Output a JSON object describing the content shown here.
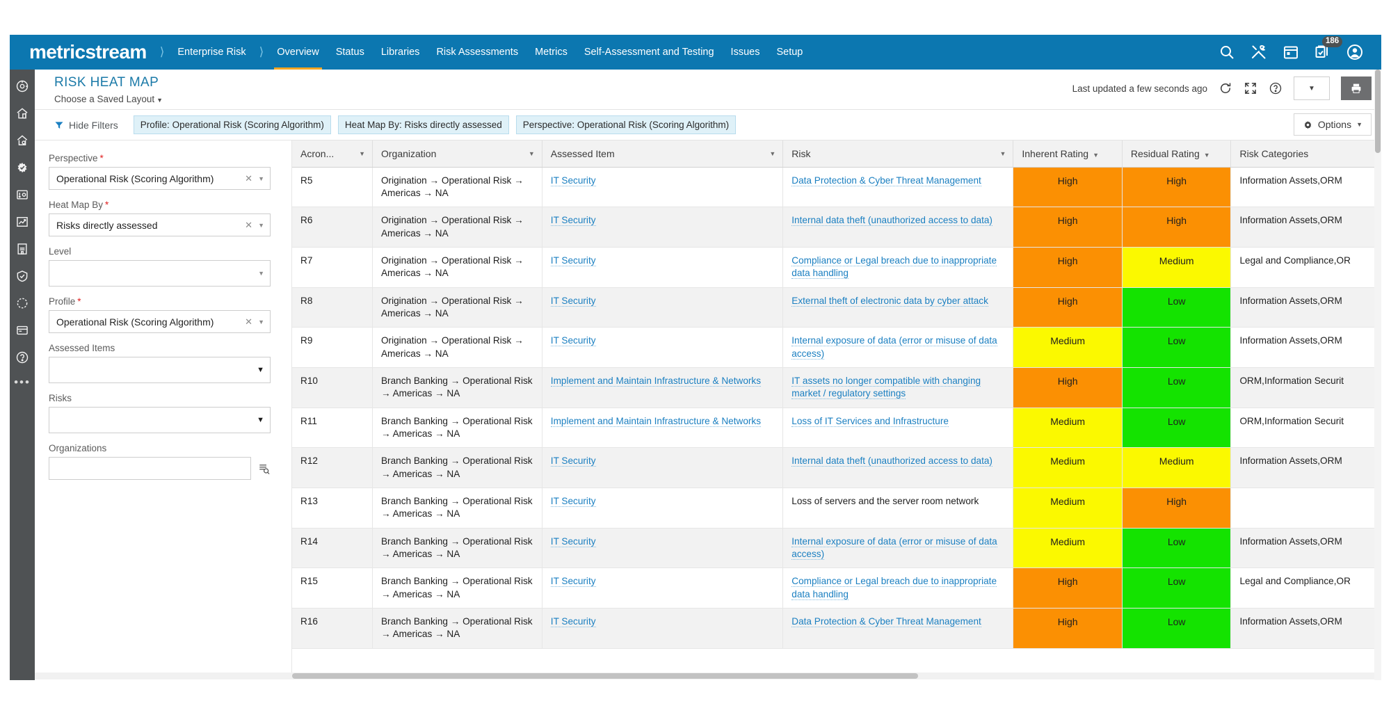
{
  "topnav": {
    "brand": "metricstream",
    "breadcrumb": "Enterprise Risk",
    "items": [
      {
        "label": "Overview",
        "active": true
      },
      {
        "label": "Status",
        "active": false
      },
      {
        "label": "Libraries",
        "active": false
      },
      {
        "label": "Risk Assessments",
        "active": false
      },
      {
        "label": "Metrics",
        "active": false
      },
      {
        "label": "Self-Assessment and Testing",
        "active": false
      },
      {
        "label": "Issues",
        "active": false
      },
      {
        "label": "Setup",
        "active": false
      }
    ],
    "icons": [
      "search-icon",
      "tools-icon",
      "calendar-icon",
      "tasks-icon",
      "user-avatar-icon"
    ],
    "task_badge": "186",
    "accent_color": "#0c77b0",
    "active_underline_color": "#f5a623"
  },
  "rail": {
    "icons": [
      "dashboard-icon",
      "home-risk-icon",
      "risk-icon",
      "gear-check-icon",
      "assessment-icon",
      "chart-trend-icon",
      "building-icon",
      "shield-icon",
      "refresh-cycle-icon",
      "archive-icon",
      "help-icon"
    ],
    "more": "•••"
  },
  "header": {
    "title": "RISK HEAT MAP",
    "saved_layout": "Choose a Saved Layout",
    "last_updated": "Last updated a few seconds ago",
    "actions": [
      "refresh-icon",
      "fullscreen-icon",
      "help-circle-icon",
      "dropdown-caret-button",
      "print-button"
    ]
  },
  "filterbar": {
    "toggle_label": "Hide Filters",
    "chips": [
      "Profile: Operational Risk (Scoring Algorithm)",
      "Heat Map By: Risks directly assessed",
      "Perspective: Operational Risk (Scoring Algorithm)"
    ],
    "options_label": "Options"
  },
  "filters": [
    {
      "label": "Perspective",
      "required": true,
      "value": "Operational Risk (Scoring Algorithm)",
      "clearable": true,
      "kind": "select"
    },
    {
      "label": "Heat Map By",
      "required": true,
      "value": "Risks directly assessed",
      "clearable": true,
      "kind": "select"
    },
    {
      "label": "Level",
      "required": false,
      "value": "",
      "clearable": false,
      "kind": "select"
    },
    {
      "label": "Profile",
      "required": true,
      "value": "Operational Risk (Scoring Algorithm)",
      "clearable": true,
      "kind": "select"
    },
    {
      "label": "Assessed Items",
      "required": false,
      "value": "",
      "clearable": false,
      "kind": "multiselect"
    },
    {
      "label": "Risks",
      "required": false,
      "value": "",
      "clearable": false,
      "kind": "multiselect"
    },
    {
      "label": "Organizations",
      "required": false,
      "value": "",
      "clearable": false,
      "kind": "lookup"
    }
  ],
  "table": {
    "columns": [
      {
        "label": "Acron...",
        "caret": true,
        "caret_inline": false
      },
      {
        "label": "Organization",
        "caret": true,
        "caret_inline": false
      },
      {
        "label": "Assessed Item",
        "caret": true,
        "caret_inline": false
      },
      {
        "label": "Risk",
        "caret": true,
        "caret_inline": false
      },
      {
        "label": "Inherent Rating",
        "caret": true,
        "caret_inline": true
      },
      {
        "label": "Residual Rating",
        "caret": true,
        "caret_inline": true
      },
      {
        "label": "Risk Categories",
        "caret": false,
        "caret_inline": false
      }
    ],
    "rows": [
      {
        "acronym": "R5",
        "organization": "Origination → Operational Risk → Americas → NA",
        "assessed_item": "IT Security",
        "assessed_item_link": true,
        "risk": "Data Protection & Cyber Threat Management",
        "risk_link": true,
        "inherent": "High",
        "residual": "High",
        "categories": "Information Assets,ORM"
      },
      {
        "acronym": "R6",
        "organization": "Origination → Operational Risk → Americas → NA",
        "assessed_item": "IT Security",
        "assessed_item_link": true,
        "risk": "Internal data theft (unauthorized access to data)",
        "risk_link": true,
        "inherent": "High",
        "residual": "High",
        "categories": "Information Assets,ORM"
      },
      {
        "acronym": "R7",
        "organization": "Origination → Operational Risk → Americas → NA",
        "assessed_item": "IT Security",
        "assessed_item_link": true,
        "risk": "Compliance or Legal breach due to inappropriate data handling",
        "risk_link": true,
        "inherent": "High",
        "residual": "Medium",
        "categories": "Legal and Compliance,OR"
      },
      {
        "acronym": "R8",
        "organization": "Origination → Operational Risk → Americas → NA",
        "assessed_item": "IT Security",
        "assessed_item_link": true,
        "risk": "External theft of electronic data by cyber attack",
        "risk_link": true,
        "inherent": "High",
        "residual": "Low",
        "categories": "Information Assets,ORM"
      },
      {
        "acronym": "R9",
        "organization": "Origination → Operational Risk → Americas → NA",
        "assessed_item": "IT Security",
        "assessed_item_link": true,
        "risk": "Internal exposure of data (error or misuse of data access)",
        "risk_link": true,
        "inherent": "Medium",
        "residual": "Low",
        "categories": "Information Assets,ORM"
      },
      {
        "acronym": "R10",
        "organization": "Branch Banking → Operational Risk → Americas → NA",
        "assessed_item": "Implement and Maintain Infrastructure & Networks",
        "assessed_item_link": true,
        "risk": "IT assets no longer compatible with changing market / regulatory settings",
        "risk_link": true,
        "inherent": "High",
        "residual": "Low",
        "categories": "ORM,Information Securit"
      },
      {
        "acronym": "R11",
        "organization": "Branch Banking → Operational Risk → Americas → NA",
        "assessed_item": "Implement and Maintain Infrastructure & Networks",
        "assessed_item_link": true,
        "risk": "Loss of IT Services and Infrastructure",
        "risk_link": true,
        "inherent": "Medium",
        "residual": "Low",
        "categories": "ORM,Information Securit"
      },
      {
        "acronym": "R12",
        "organization": "Branch Banking → Operational Risk → Americas → NA",
        "assessed_item": "IT Security",
        "assessed_item_link": true,
        "risk": "Internal data theft (unauthorized access to data)",
        "risk_link": true,
        "inherent": "Medium",
        "residual": "Medium",
        "categories": "Information Assets,ORM"
      },
      {
        "acronym": "R13",
        "organization": "Branch Banking → Operational Risk → Americas → NA",
        "assessed_item": "IT Security",
        "assessed_item_link": true,
        "risk": "Loss of servers and the server room network",
        "risk_link": false,
        "inherent": "Medium",
        "residual": "High",
        "categories": ""
      },
      {
        "acronym": "R14",
        "organization": "Branch Banking → Operational Risk → Americas → NA",
        "assessed_item": "IT Security",
        "assessed_item_link": true,
        "risk": "Internal exposure of data (error or misuse of data access)",
        "risk_link": true,
        "inherent": "Medium",
        "residual": "Low",
        "categories": "Information Assets,ORM"
      },
      {
        "acronym": "R15",
        "organization": "Branch Banking → Operational Risk → Americas → NA",
        "assessed_item": "IT Security",
        "assessed_item_link": true,
        "risk": "Compliance or Legal breach due to inappropriate data handling",
        "risk_link": true,
        "inherent": "High",
        "residual": "Low",
        "categories": "Legal and Compliance,OR"
      },
      {
        "acronym": "R16",
        "organization": "Branch Banking → Operational Risk → Americas → NA",
        "assessed_item": "IT Security",
        "assessed_item_link": true,
        "risk": "Data Protection & Cyber Threat Management",
        "risk_link": true,
        "inherent": "High",
        "residual": "Low",
        "categories": "Information Assets,ORM"
      }
    ],
    "rating_colors": {
      "High": "#fb9003",
      "Medium": "#fbf900",
      "Low": "#14e300"
    }
  }
}
